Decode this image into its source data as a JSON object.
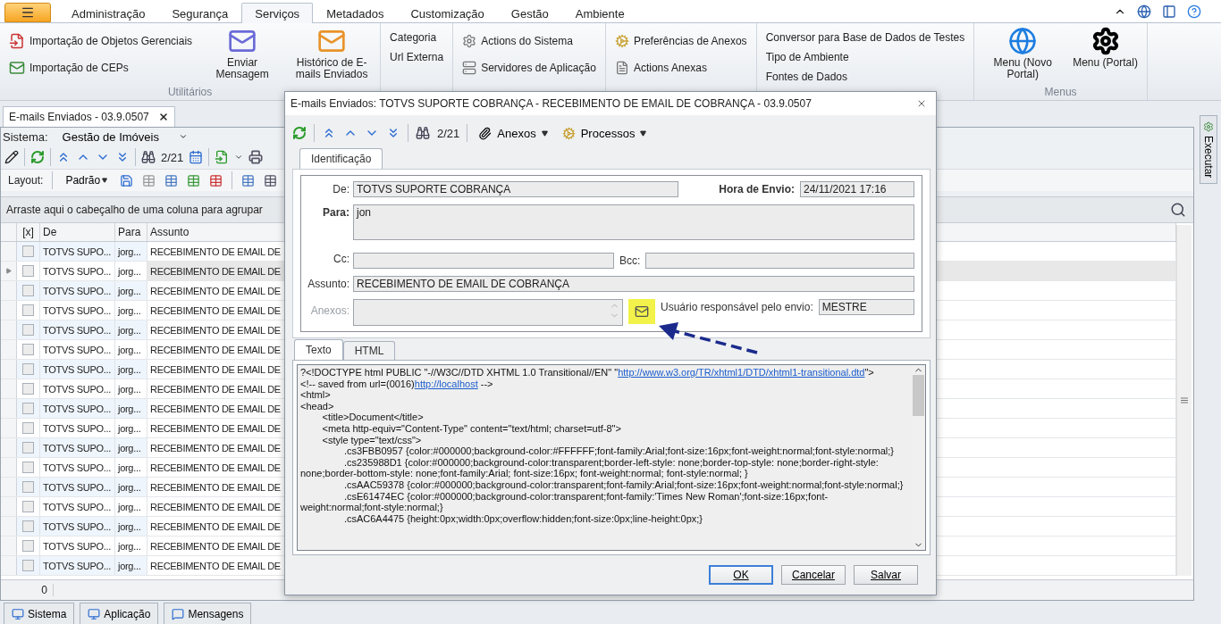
{
  "ribbon_tabs": [
    {
      "label": "Administração",
      "selected": false
    },
    {
      "label": "Segurança",
      "selected": false
    },
    {
      "label": "Serviços",
      "selected": true
    },
    {
      "label": "Metadados",
      "selected": false
    },
    {
      "label": "Customização",
      "selected": false
    },
    {
      "label": "Gestão",
      "selected": false
    },
    {
      "label": "Ambiente",
      "selected": false
    }
  ],
  "ribbon_groups": [
    {
      "label": "Utilitários",
      "items": [
        {
          "kind": "small",
          "label": "Importação de Objetos Gerenciais"
        },
        {
          "kind": "small",
          "label": "Importação de CEPs"
        },
        {
          "kind": "large",
          "label": "Enviar Mensagem"
        },
        {
          "kind": "large",
          "label": "Histórico de E-mails Enviados"
        }
      ]
    },
    {
      "items": [
        {
          "kind": "text",
          "label": "Categoria"
        },
        {
          "kind": "text",
          "label": "Url Externa"
        }
      ]
    },
    {
      "items": [
        {
          "kind": "small",
          "label": "Actions do Sistema"
        },
        {
          "kind": "small",
          "label": "Servidores de Aplicação"
        }
      ]
    },
    {
      "items": [
        {
          "kind": "small",
          "label": "Preferências de Anexos"
        },
        {
          "kind": "small",
          "label": "Actions Anexas"
        }
      ]
    },
    {
      "items": [
        {
          "kind": "text",
          "label": "Conversor para Base de Dados de Testes"
        },
        {
          "kind": "text",
          "label": "Tipo de Ambiente"
        },
        {
          "kind": "text",
          "label": "Fontes de Dados"
        }
      ]
    },
    {
      "label": "Menus",
      "items": [
        {
          "kind": "large",
          "label": "Menu (Novo Portal)"
        },
        {
          "kind": "large",
          "label": "Menu (Portal)"
        }
      ]
    }
  ],
  "document_tab": {
    "label": "E-mails Enviados - 03.9.0507"
  },
  "system": {
    "label": "Sistema:",
    "value": "Gestão de Imóveis"
  },
  "toolbar": {
    "counter": "2/21"
  },
  "layout_bar": {
    "label": "Layout:",
    "value": "Padrão"
  },
  "group_panel": "Arraste aqui o cabeçalho de uma coluna para agrupar",
  "side_tab": "Executar",
  "table": {
    "columns": [
      "[x]",
      "De",
      "Para",
      "Assunto"
    ],
    "rows": [
      {
        "selected": false,
        "checked": false,
        "de": "TOTVS SUPO...",
        "para": "jorg...",
        "assunto": "RECEBIMENTO DE EMAIL DE"
      },
      {
        "selected": true,
        "checked": false,
        "de": "TOTVS SUPO...",
        "para": "jorg...",
        "assunto": "RECEBIMENTO DE EMAIL DE"
      },
      {
        "selected": false,
        "checked": false,
        "de": "TOTVS SUPO...",
        "para": "jorg...",
        "assunto": "RECEBIMENTO DE EMAIL DE"
      },
      {
        "selected": false,
        "checked": false,
        "de": "TOTVS SUPO...",
        "para": "jorg...",
        "assunto": "RECEBIMENTO DE EMAIL DE"
      },
      {
        "selected": false,
        "checked": false,
        "de": "TOTVS SUPO...",
        "para": "jorg...",
        "assunto": "RECEBIMENTO DE EMAIL DE"
      },
      {
        "selected": false,
        "checked": false,
        "de": "TOTVS SUPO...",
        "para": "jorg...",
        "assunto": "RECEBIMENTO DE EMAIL DE"
      },
      {
        "selected": false,
        "checked": false,
        "de": "TOTVS SUPO...",
        "para": "jorg...",
        "assunto": "RECEBIMENTO DE EMAIL DE"
      },
      {
        "selected": false,
        "checked": false,
        "de": "TOTVS SUPO...",
        "para": "jorg...",
        "assunto": "RECEBIMENTO DE EMAIL DE"
      },
      {
        "selected": false,
        "checked": false,
        "de": "TOTVS SUPO...",
        "para": "jorg...",
        "assunto": "RECEBIMENTO DE EMAIL DE"
      },
      {
        "selected": false,
        "checked": false,
        "de": "TOTVS SUPO...",
        "para": "jorg...",
        "assunto": "RECEBIMENTO DE EMAIL DE"
      },
      {
        "selected": false,
        "checked": false,
        "de": "TOTVS SUPO...",
        "para": "jorg...",
        "assunto": "RECEBIMENTO DE EMAIL DE"
      },
      {
        "selected": false,
        "checked": false,
        "de": "TOTVS SUPO...",
        "para": "jorg...",
        "assunto": "RECEBIMENTO DE EMAIL DE"
      },
      {
        "selected": false,
        "checked": false,
        "de": "TOTVS SUPO...",
        "para": "jorg...",
        "assunto": "RECEBIMENTO DE EMAIL DE"
      },
      {
        "selected": false,
        "checked": false,
        "de": "TOTVS SUPO...",
        "para": "jorg...",
        "assunto": "RECEBIMENTO DE EMAIL DE"
      },
      {
        "selected": false,
        "checked": false,
        "de": "TOTVS SUPO...",
        "para": "jorg...",
        "assunto": "RECEBIMENTO DE EMAIL DE"
      },
      {
        "selected": false,
        "checked": false,
        "de": "TOTVS SUPO...",
        "para": "jorg...",
        "assunto": "RECEBIMENTO DE EMAIL DE"
      },
      {
        "selected": false,
        "checked": false,
        "de": "TOTVS SUPO...",
        "para": "jorg...",
        "assunto": "RECEBIMENTO DE EMAIL DE"
      }
    ],
    "footer": "0"
  },
  "taskbar": [
    {
      "label": "Sistema"
    },
    {
      "label": "Aplicação"
    },
    {
      "label": "Mensagens"
    }
  ],
  "dialog": {
    "title": "E-mails Enviados: TOTVS SUPORTE COBRANÇA - RECEBIMENTO DE EMAIL DE COBRANÇA - 03.9.0507",
    "toolbar": {
      "counter": "2/21",
      "attachments": "Anexos",
      "processes": "Processos"
    },
    "tabs": [
      {
        "label": "Identificação",
        "selected": true
      }
    ],
    "fields": {
      "de": {
        "label": "De:",
        "value": "TOTVS SUPORTE COBRANÇA"
      },
      "hora_de_envio": {
        "label": "Hora de Envio:",
        "value": "24/11/2021 17:16"
      },
      "para": {
        "label": "Para:",
        "value": "jon"
      },
      "cc": {
        "label": "Cc:"
      },
      "bcc": {
        "label": "Bcc:"
      },
      "assunto": {
        "label": "Assunto:",
        "value": "RECEBIMENTO DE EMAIL DE COBRANÇA"
      },
      "anexos": {
        "label": "Anexos:",
        "disabled": true
      },
      "usuario": {
        "label": "Usuário responsável pelo envio:",
        "value": "MESTRE"
      }
    },
    "body_tabs": [
      {
        "label": "Texto",
        "selected": true
      },
      {
        "label": "HTML",
        "selected": false
      }
    ],
    "body_lines": [
      [
        {
          "text": "?<!DOCTYPE html PUBLIC \"-//W3C//DTD XHTML 1.0 Transitional//EN\" \"",
          "link": false
        },
        {
          "text": "http://www.w3.org/TR/xhtml1/DTD/xhtml1-transitional.dtd",
          "link": true
        },
        {
          "text": "\">",
          "link": false
        }
      ],
      [
        {
          "text": "<!-- saved from url=(0016)",
          "link": false
        },
        {
          "text": "http://localhost",
          "link": true
        },
        {
          "text": " -->",
          "link": false
        }
      ],
      [
        {
          "text": "<html>",
          "link": false
        }
      ],
      [
        {
          "text": "<head>",
          "link": false
        }
      ],
      [
        {
          "text": "\t<title>Document</title>",
          "link": false
        }
      ],
      [
        {
          "text": "\t<meta http-equiv=\"Content-Type\" content=\"text/html; charset=utf-8\">",
          "link": false
        }
      ],
      [
        {
          "text": "\t<style type=\"text/css\">",
          "link": false
        }
      ],
      [
        {
          "text": "\t\t.cs3FBB0957 {color:#000000;background-color:#FFFFFF;font-family:Arial;font-size:16px;font-weight:normal;font-style:normal;}",
          "link": false
        }
      ],
      [
        {
          "text": "\t\t.cs235988D1 {color:#000000;background-color:transparent;border-left-style: none;border-top-style: none;border-right-style: none;border-bottom-style: none;font-family:Arial; font-size:16px; font-weight:normal; font-style:normal; }",
          "link": false
        }
      ],
      [
        {
          "text": "\t\t.csAAC59378 {color:#000000;background-color:transparent;font-family:Arial;font-size:16px;font-weight:normal;font-style:normal;}",
          "link": false
        }
      ],
      [
        {
          "text": "\t\t.csE61474EC {color:#000000;background-color:transparent;font-family:'Times New Roman';font-size:16px;font-weight:normal;font-style:normal;}",
          "link": false
        }
      ],
      [
        {
          "text": "\t\t.csAC6A4475 {height:0px;width:0px;overflow:hidden;font-size:0px;line-height:0px;}",
          "link": false
        }
      ]
    ],
    "buttons": [
      {
        "label": "OK",
        "default": true
      },
      {
        "label": "Cancelar",
        "default": false
      },
      {
        "label": "Salvar",
        "default": false
      }
    ]
  }
}
